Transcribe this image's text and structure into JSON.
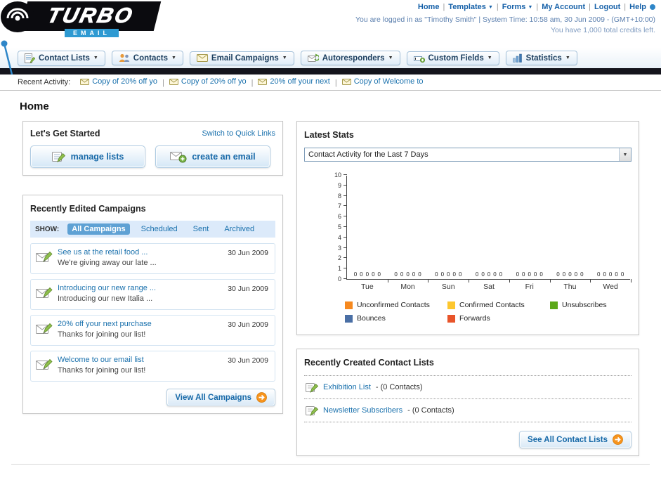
{
  "header": {
    "logo_line1": "TURBO",
    "logo_line2": "EMAIL",
    "links": [
      {
        "label": "Home",
        "caret": false
      },
      {
        "label": "Templates",
        "caret": true
      },
      {
        "label": "Forms",
        "caret": true
      },
      {
        "label": "My Account",
        "caret": false
      },
      {
        "label": "Logout",
        "caret": false
      },
      {
        "label": "Help",
        "caret": false
      }
    ],
    "login_info": "You are logged in as \"Timothy Smith\" | System Time: 10:58 am, 30 Jun 2009 - (GMT+10:00)",
    "credits": "You have 1,000 total credits left."
  },
  "main_nav": {
    "items": [
      {
        "label": "Contact Lists",
        "icon": "contact-lists-icon"
      },
      {
        "label": "Contacts",
        "icon": "contacts-icon"
      },
      {
        "label": "Email Campaigns",
        "icon": "email-campaigns-icon"
      },
      {
        "label": "Autoresponders",
        "icon": "autoresponders-icon"
      },
      {
        "label": "Custom Fields",
        "icon": "custom-fields-icon"
      },
      {
        "label": "Statistics",
        "icon": "statistics-icon"
      }
    ]
  },
  "recent_activity": {
    "label": "Recent Activity:",
    "items": [
      "Copy of 20% off yo",
      "Copy of 20% off yo",
      "20% off your next",
      "Copy of Welcome to"
    ]
  },
  "page_title": "Home",
  "get_started": {
    "title": "Let's Get Started",
    "switch_link": "Switch to Quick Links",
    "buttons": [
      {
        "label": "manage lists",
        "icon": "manage-lists-icon"
      },
      {
        "label": "create an email",
        "icon": "create-email-icon"
      }
    ]
  },
  "campaigns": {
    "title": "Recently Edited Campaigns",
    "show_label": "SHOW:",
    "tabs": [
      "All Campaigns",
      "Scheduled",
      "Sent",
      "Archived"
    ],
    "selected_tab": "All Campaigns",
    "items": [
      {
        "title": "See us at the retail food ...",
        "subtitle": "We're giving away our late ...",
        "date": "30 Jun 2009"
      },
      {
        "title": "Introducing our new range ...",
        "subtitle": "Introducing our new Italia ...",
        "date": "30 Jun 2009"
      },
      {
        "title": "20% off your next purchase",
        "subtitle": "Thanks for joining our list!",
        "date": "30 Jun 2009"
      },
      {
        "title": "Welcome to our email list",
        "subtitle": "Thanks for joining our list!",
        "date": "30 Jun 2009"
      }
    ],
    "view_all_label": "View All Campaigns"
  },
  "stats": {
    "title": "Latest Stats",
    "dropdown_value": "Contact Activity for the Last 7 Days",
    "chart_data": {
      "type": "bar",
      "title": "Contact Activity for the Last 7 Days",
      "categories": [
        "Tue",
        "Mon",
        "Sun",
        "Sat",
        "Fri",
        "Thu",
        "Wed"
      ],
      "series": [
        {
          "name": "Unconfirmed Contacts",
          "color": "#f6891f",
          "values": [
            0,
            0,
            0,
            0,
            0,
            0,
            0
          ]
        },
        {
          "name": "Confirmed Contacts",
          "color": "#fdc72f",
          "values": [
            0,
            0,
            0,
            0,
            0,
            0,
            0
          ]
        },
        {
          "name": "Unsubscribes",
          "color": "#5ba818",
          "values": [
            0,
            0,
            0,
            0,
            0,
            0,
            0
          ]
        },
        {
          "name": "Bounces",
          "color": "#4a6fa5",
          "values": [
            0,
            0,
            0,
            0,
            0,
            0,
            0
          ]
        },
        {
          "name": "Forwards",
          "color": "#e8542a",
          "values": [
            0,
            0,
            0,
            0,
            0,
            0,
            0
          ]
        }
      ],
      "ylim": [
        0,
        10
      ],
      "ytick_step": 1,
      "grid": false,
      "legend_position": "bottom"
    }
  },
  "contact_lists": {
    "title": "Recently Created Contact Lists",
    "items": [
      {
        "name": "Exhibition List",
        "suffix": "- (0 Contacts)"
      },
      {
        "name": "Newsletter Subscribers",
        "suffix": "- (0 Contacts)"
      }
    ],
    "see_all_label": "See All Contact Lists"
  }
}
